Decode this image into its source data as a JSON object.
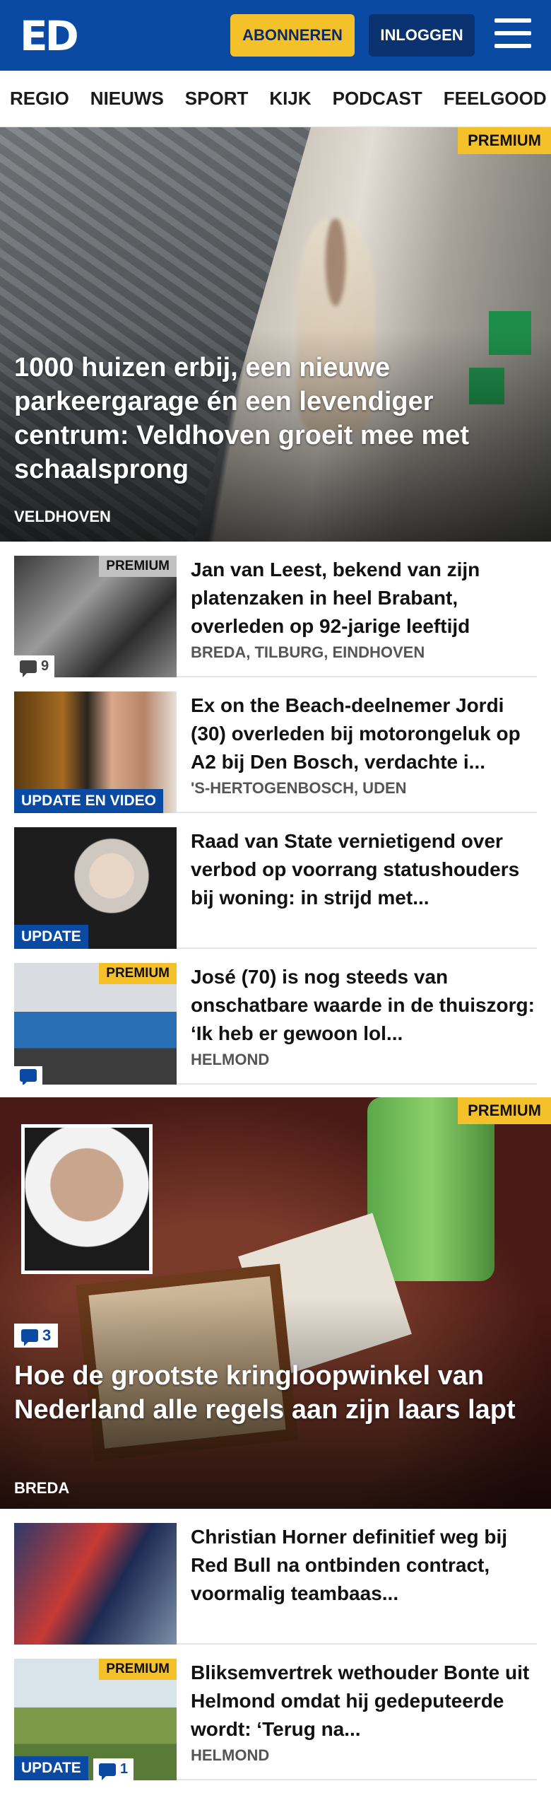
{
  "header": {
    "logo": "ED",
    "subscribe_label": "ABONNEREN",
    "login_label": "INLOGGEN"
  },
  "nav": [
    "REGIO",
    "NIEUWS",
    "SPORT",
    "KIJK",
    "PODCAST",
    "FEELGOOD"
  ],
  "premium_label": "PREMIUM",
  "hero1": {
    "title": "1000 huizen erbij, een nieuwe parkeergarage én een levendiger centrum: Veldhoven groeit mee met schaalsprong",
    "kicker": "VELDHOVEN"
  },
  "articles": [
    {
      "title": "Jan van Leest, bekend van zijn platenzaken in heel Brabant, overleden op 92-jarige leeftijd",
      "location": "BREDA, TILBURG, EINDHOVEN",
      "comments": "9"
    },
    {
      "title": "Ex on the Beach-deelnemer Jordi (30) overleden bij motorongeluk op A2 bij Den Bosch, verdachte i...",
      "location": "'S-HERTOGENBOSCH, UDEN",
      "label": "UPDATE EN VIDEO"
    },
    {
      "title": "Raad van State vernietigend over verbod op voorrang statushou­ders bij woning: in strijd met...",
      "label": "UPDATE"
    },
    {
      "title": "José (70) is nog steeds van onschatbare waarde in de thuiszorg: ‘Ik heb er gewoon lol...",
      "location": "HELMOND"
    }
  ],
  "hero2": {
    "title": "Hoe de grootste kringloopwinkel van Nederland alle regels aan zijn laars lapt",
    "kicker": "BREDA",
    "comments": "3"
  },
  "articles2": [
    {
      "title": "Christian Horner definitief weg bij Red Bull na ontbinden contract, voormalig teambaas..."
    },
    {
      "title": "Bliksemvertrek wethouder Bonte uit Helmond omdat hij gedeputeerde wordt: ‘Terug na...",
      "location": "HELMOND",
      "label": "UPDATE",
      "comments": "1"
    }
  ]
}
